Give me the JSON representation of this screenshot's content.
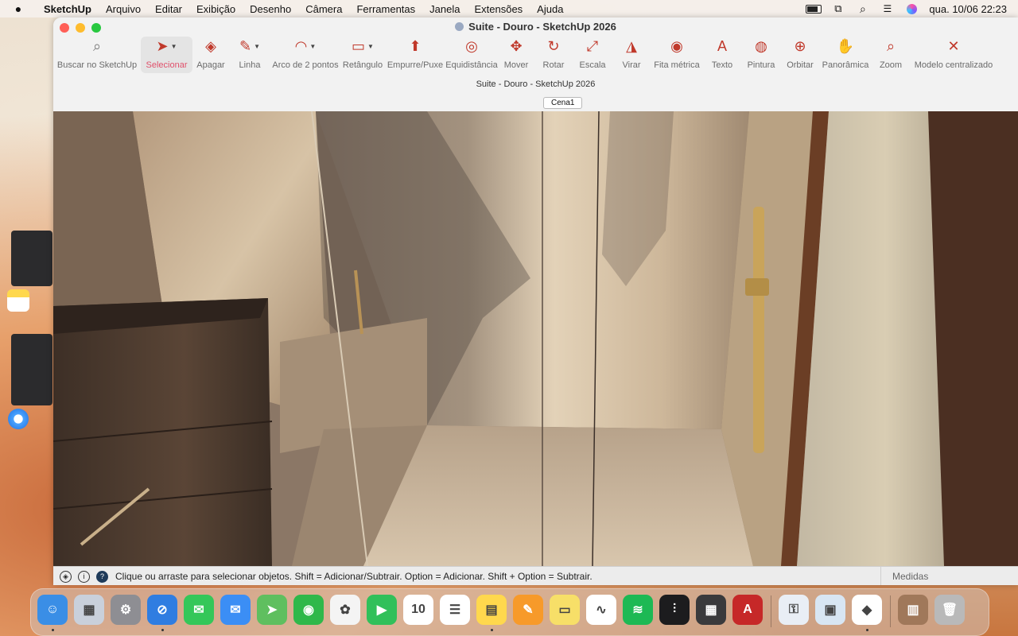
{
  "menubar": {
    "apple": "",
    "app": "SketchUp",
    "items": [
      "Arquivo",
      "Editar",
      "Exibição",
      "Desenho",
      "Câmera",
      "Ferramentas",
      "Janela",
      "Extensões",
      "Ajuda"
    ],
    "clock": "qua. 10/06  22:23"
  },
  "window": {
    "title": "Suite - Douro - SketchUp 2026",
    "subtitle": "Suite - Douro - SketchUp 2026",
    "scene_tab": "Cena1"
  },
  "toolbar": {
    "tools": [
      {
        "label": "Buscar no SketchUp",
        "icon": "search-icon",
        "glyph": "⌕"
      },
      {
        "label": "Selecionar",
        "icon": "select-arrow-icon",
        "glyph": "➤"
      },
      {
        "label": "Apagar",
        "icon": "eraser-icon",
        "glyph": "◈"
      },
      {
        "label": "Linha",
        "icon": "pencil-icon",
        "glyph": "✎"
      },
      {
        "label": "Arco de 2 pontos",
        "icon": "arc-icon",
        "glyph": "◠"
      },
      {
        "label": "Retângulo",
        "icon": "rectangle-icon",
        "glyph": "▭"
      },
      {
        "label": "Empurre/Puxe",
        "icon": "push-pull-icon",
        "glyph": "⬆"
      },
      {
        "label": "Equidistância",
        "icon": "offset-icon",
        "glyph": "◎"
      },
      {
        "label": "Mover",
        "icon": "move-icon",
        "glyph": "✥"
      },
      {
        "label": "Rotar",
        "icon": "rotate-icon",
        "glyph": "↻"
      },
      {
        "label": "Escala",
        "icon": "scale-icon",
        "glyph": "⤢"
      },
      {
        "label": "Virar",
        "icon": "flip-icon",
        "glyph": "◮"
      },
      {
        "label": "Fita métrica",
        "icon": "tape-measure-icon",
        "glyph": "◉"
      },
      {
        "label": "Texto",
        "icon": "text-icon",
        "glyph": "A"
      },
      {
        "label": "Pintura",
        "icon": "paint-bucket-icon",
        "glyph": "◍"
      },
      {
        "label": "Orbitar",
        "icon": "orbit-icon",
        "glyph": "⊕"
      },
      {
        "label": "Panorâmica",
        "icon": "pan-hand-icon",
        "glyph": "✋"
      },
      {
        "label": "Zoom",
        "icon": "zoom-icon",
        "glyph": "⌕"
      },
      {
        "label": "Modelo centralizado",
        "icon": "zoom-extents-icon",
        "glyph": "✕"
      }
    ]
  },
  "status": {
    "text": "Clique ou arraste para selecionar objetos. Shift = Adicionar/Subtrair. Option = Adicionar. Shift + Option = Subtrair.",
    "measures_label": "Medidas"
  },
  "dock": {
    "apps": [
      {
        "name": "Finder",
        "icon": "finder-icon",
        "color": "#3a8ee6",
        "glyph": "☺"
      },
      {
        "name": "Launchpad",
        "icon": "launchpad-icon",
        "color": "#c9d0db",
        "glyph": "▦"
      },
      {
        "name": "System Settings",
        "icon": "settings-icon",
        "color": "#8e8e93",
        "glyph": "⚙"
      },
      {
        "name": "Safari",
        "icon": "safari-icon",
        "color": "#2f7de1",
        "glyph": "⊘"
      },
      {
        "name": "Messages",
        "icon": "messages-icon",
        "color": "#34c759",
        "glyph": "✉"
      },
      {
        "name": "Mail",
        "icon": "mail-icon",
        "color": "#3b8ef5",
        "glyph": "✉"
      },
      {
        "name": "Maps",
        "icon": "maps-icon",
        "color": "#5fbf5f",
        "glyph": "➤"
      },
      {
        "name": "Find My",
        "icon": "findmy-icon",
        "color": "#2fb84a",
        "glyph": "◉"
      },
      {
        "name": "Photos",
        "icon": "photos-icon",
        "color": "#f4f4f4",
        "glyph": "✿"
      },
      {
        "name": "FaceTime",
        "icon": "facetime-icon",
        "color": "#31c05a",
        "glyph": "▶"
      },
      {
        "name": "Calendar",
        "icon": "calendar-icon",
        "color": "#ffffff",
        "glyph": "10"
      },
      {
        "name": "Reminders",
        "icon": "reminders-icon",
        "color": "#ffffff",
        "glyph": "☰"
      },
      {
        "name": "Notes",
        "icon": "notes-icon",
        "color": "#ffd84d",
        "glyph": "▤"
      },
      {
        "name": "Pages",
        "icon": "pages-icon",
        "color": "#f79a2a",
        "glyph": "✎"
      },
      {
        "name": "Stickies",
        "icon": "stickies-icon",
        "color": "#f7df68",
        "glyph": "▭"
      },
      {
        "name": "Freeform",
        "icon": "freeform-icon",
        "color": "#ffffff",
        "glyph": "∿"
      },
      {
        "name": "Spotify",
        "icon": "spotify-icon",
        "color": "#1db954",
        "glyph": "≋"
      },
      {
        "name": "Voice Memos",
        "icon": "voice-memos-icon",
        "color": "#1c1c1e",
        "glyph": "⫶"
      },
      {
        "name": "Calculator",
        "icon": "calculator-icon",
        "color": "#3a3a3c",
        "glyph": "▦"
      },
      {
        "name": "AutoCAD",
        "icon": "autocad-icon",
        "color": "#c62828",
        "glyph": "A"
      },
      {
        "name": "Keychain",
        "icon": "keychain-icon",
        "color": "#e9eef5",
        "glyph": "⚿"
      },
      {
        "name": "Preview",
        "icon": "preview-icon",
        "color": "#d8e6f3",
        "glyph": "▣"
      },
      {
        "name": "SketchUp",
        "icon": "sketchup-icon",
        "color": "#ffffff",
        "glyph": "◆"
      },
      {
        "name": "Downloads",
        "icon": "downloads-folder-icon",
        "color": "#a0785a",
        "glyph": "▥"
      },
      {
        "name": "Trash",
        "icon": "trash-icon",
        "color": "#b9b9b9",
        "glyph": "🗑"
      }
    ]
  }
}
